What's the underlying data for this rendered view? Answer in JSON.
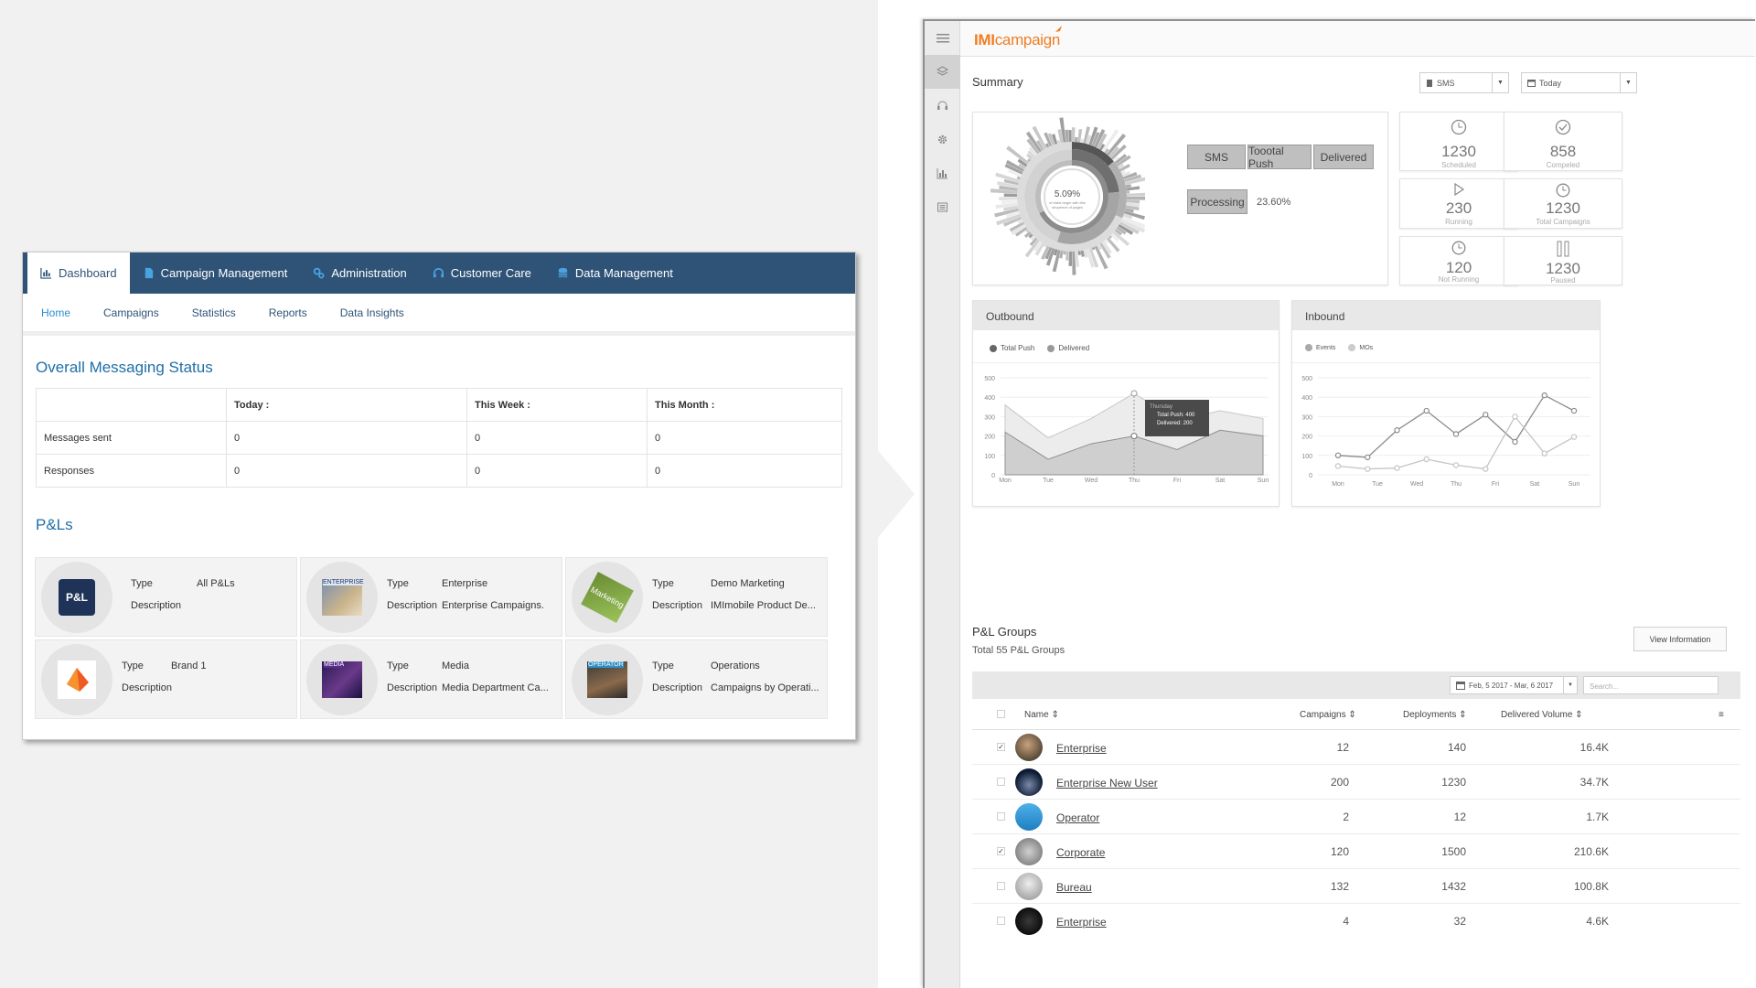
{
  "left": {
    "top_nav": [
      {
        "label": "Dashboard",
        "icon": "chart-icon",
        "active": true
      },
      {
        "label": "Campaign Management",
        "icon": "document-icon"
      },
      {
        "label": "Administration",
        "icon": "gears-icon"
      },
      {
        "label": "Customer Care",
        "icon": "headset-icon"
      },
      {
        "label": "Data Management",
        "icon": "database-icon"
      }
    ],
    "sub_nav": [
      "Home",
      "Campaigns",
      "Statistics",
      "Reports",
      "Data Insights"
    ],
    "messaging_title": "Overall Messaging Status",
    "table": {
      "headers": [
        "",
        "Today :",
        "This Week :",
        "This Month :"
      ],
      "rows": [
        [
          "Messages sent",
          "0",
          "0",
          "0"
        ],
        [
          "Responses",
          "0",
          "0",
          "0"
        ]
      ]
    },
    "pls_title": "P&Ls",
    "pl_cards": [
      {
        "type_label": "Type",
        "type": "All P&Ls",
        "desc_label": "Description",
        "desc": "",
        "thumb": "P&L"
      },
      {
        "type_label": "Type",
        "type": "Enterprise",
        "desc_label": "Description",
        "desc": "Enterprise Campaigns.",
        "thumb": "ENTERPRISE"
      },
      {
        "type_label": "Type",
        "type": "Demo Marketing",
        "desc_label": "Description",
        "desc": "IMImobile Product De...",
        "thumb": "Marketing"
      },
      {
        "type_label": "Type",
        "type": "Brand 1",
        "desc_label": "Description",
        "desc": "",
        "thumb": ""
      },
      {
        "type_label": "Type",
        "type": "Media",
        "desc_label": "Description",
        "desc": "Media Department Ca...",
        "thumb": "MEDIA"
      },
      {
        "type_label": "Type",
        "type": "Operations",
        "desc_label": "Description",
        "desc": "Campaigns by Operati...",
        "thumb": "OPERATOR"
      }
    ]
  },
  "right": {
    "logo_bold": "IMI",
    "logo_rest": "campaign",
    "summary_title": "Summary",
    "channel_select": "SMS",
    "date_select": "Today",
    "sunburst_center": "5.09%",
    "sunburst_sub": "of visits begin with this sequence of pages",
    "breadcrumb_tags": [
      "SMS",
      "Toootal Push",
      "Delivered"
    ],
    "processing_tag": "Processing",
    "processing_value": "23.60%",
    "stats": [
      {
        "value": "1230",
        "label": "Scheduled",
        "icon": "clock-icon"
      },
      {
        "value": "858",
        "label": "Compeled",
        "icon": "check-circle-icon"
      },
      {
        "value": "230",
        "label": "Running",
        "icon": "play-icon"
      },
      {
        "value": "1230",
        "label": "Total Campaigns",
        "icon": "clock-icon"
      },
      {
        "value": "120",
        "label": "Not Running",
        "icon": "clock-icon"
      },
      {
        "value": "1230",
        "label": "Paused",
        "icon": "pause-icon"
      }
    ],
    "outbound_title": "Outbound",
    "inbound_title": "Inbound",
    "tooltip": {
      "day": "Thursday",
      "push": "Total Push: 400",
      "delivered": "Delivered:  200"
    },
    "groups_title": "P&L Groups",
    "groups_sub": "Total 55 P&L Groups",
    "view_button": "View Information",
    "date_range": "Feb, 5 2017 - Mar, 6 2017",
    "search_placeholder": "Search...",
    "columns": [
      "Name",
      "Campaigns",
      "Deployments",
      "Delivered Volume"
    ],
    "rows": [
      {
        "name": "Enterprise",
        "campaigns": "12",
        "deployments": "140",
        "volume": "16.4K",
        "checked": true
      },
      {
        "name": "Enterprise New User",
        "campaigns": "200",
        "deployments": "1230",
        "volume": "34.7K",
        "checked": false
      },
      {
        "name": "Operator",
        "campaigns": "2",
        "deployments": "12",
        "volume": "1.7K",
        "checked": false
      },
      {
        "name": "Corporate",
        "campaigns": "120",
        "deployments": "1500",
        "volume": "210.6K",
        "checked": true
      },
      {
        "name": "Bureau",
        "campaigns": "132",
        "deployments": "1432",
        "volume": "100.8K",
        "checked": false
      },
      {
        "name": "Enterprise",
        "campaigns": "4",
        "deployments": "32",
        "volume": "4.6K",
        "checked": false
      }
    ]
  },
  "chart_data": [
    {
      "type": "area",
      "title": "Outbound",
      "categories": [
        "Mon",
        "Tue",
        "Wed",
        "Thu",
        "Fri",
        "Sat",
        "Sun"
      ],
      "ylim": [
        0,
        500
      ],
      "yticks": [
        0,
        100,
        200,
        300,
        400,
        500
      ],
      "series": [
        {
          "name": "Total Push",
          "values": [
            360,
            190,
            290,
            420,
            280,
            330,
            290
          ]
        },
        {
          "name": "Delivered",
          "values": [
            220,
            80,
            160,
            200,
            130,
            230,
            200
          ]
        }
      ]
    },
    {
      "type": "line",
      "title": "Inbound",
      "categories": [
        "Mon",
        "Tue",
        "Wed",
        "Thu",
        "Fri",
        "Sat",
        "Sun"
      ],
      "ylim": [
        0,
        500
      ],
      "yticks": [
        0,
        100,
        200,
        300,
        400,
        500
      ],
      "series": [
        {
          "name": "Events",
          "values": [
            100,
            90,
            230,
            330,
            210,
            310,
            170,
            410,
            330
          ]
        },
        {
          "name": "MOs",
          "values": [
            45,
            30,
            35,
            80,
            50,
            30,
            300,
            110,
            195
          ]
        }
      ]
    }
  ]
}
